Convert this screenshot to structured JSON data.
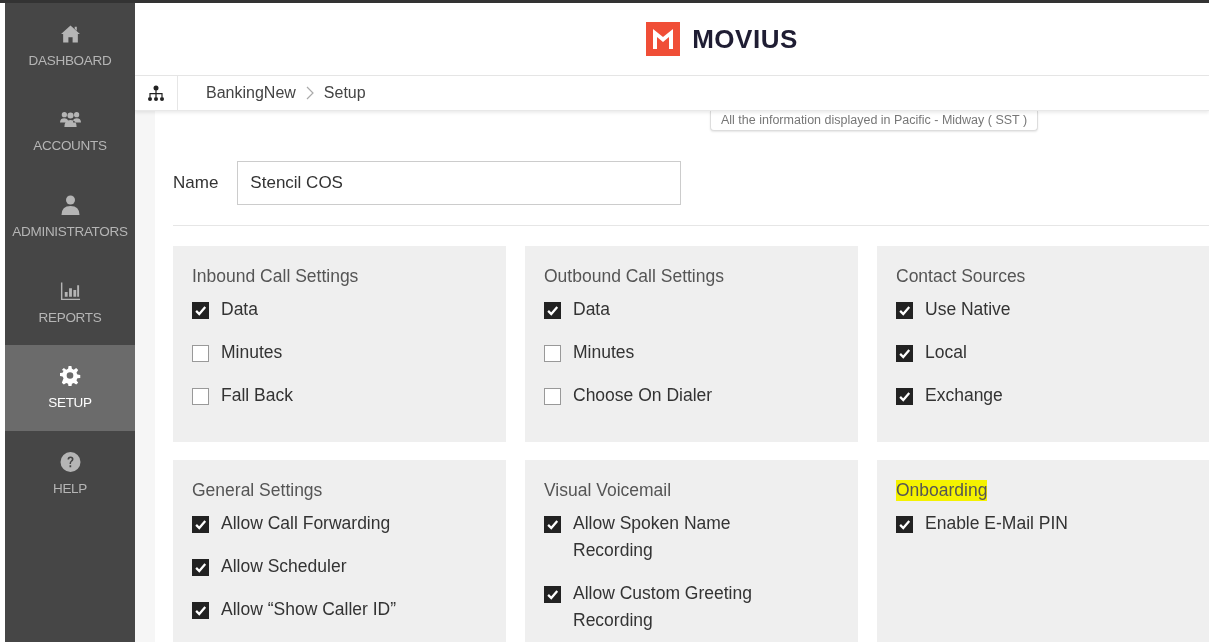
{
  "sidebar": {
    "items": [
      {
        "label": "DASHBOARD",
        "kind": "home",
        "selected": false
      },
      {
        "label": "ACCOUNTS",
        "kind": "users",
        "selected": false
      },
      {
        "label": "ADMINISTRATORS",
        "kind": "admin",
        "selected": false
      },
      {
        "label": "REPORTS",
        "kind": "chart",
        "selected": false
      },
      {
        "label": "SETUP",
        "kind": "gear",
        "selected": true
      },
      {
        "label": "HELP",
        "kind": "help",
        "selected": false
      }
    ]
  },
  "header": {
    "logo_text": "MOVIUS"
  },
  "breadcrumb": [
    "BankingNew",
    "Setup"
  ],
  "timezone_note": "All the information displayed in Pacific - Midway ( SST )",
  "name_field": {
    "label": "Name",
    "value": "Stencil COS"
  },
  "sections": [
    {
      "title": "Inbound Call Settings",
      "highlighted": false,
      "items": [
        {
          "label": "Data",
          "checked": true
        },
        {
          "label": "Minutes",
          "checked": false
        },
        {
          "label": "Fall Back",
          "checked": false
        }
      ]
    },
    {
      "title": "Outbound Call Settings",
      "highlighted": false,
      "items": [
        {
          "label": "Data",
          "checked": true
        },
        {
          "label": "Minutes",
          "checked": false
        },
        {
          "label": "Choose On Dialer",
          "checked": false
        }
      ]
    },
    {
      "title": "Contact Sources",
      "highlighted": false,
      "items": [
        {
          "label": "Use Native",
          "checked": true
        },
        {
          "label": "Local",
          "checked": true
        },
        {
          "label": "Exchange",
          "checked": true
        }
      ]
    },
    {
      "title": "General Settings",
      "highlighted": false,
      "items": [
        {
          "label": "Allow Call Forwarding",
          "checked": true
        },
        {
          "label": "Allow Scheduler",
          "checked": true
        },
        {
          "label": "Allow “Show Caller ID”",
          "checked": true
        }
      ]
    },
    {
      "title": "Visual Voicemail",
      "highlighted": false,
      "items": [
        {
          "label": "Allow Spoken Name Recording",
          "checked": true
        },
        {
          "label": "Allow Custom Greeting Recording",
          "checked": true
        }
      ]
    },
    {
      "title": "Onboarding",
      "highlighted": true,
      "items": [
        {
          "label": "Enable E-Mail PIN",
          "checked": true
        }
      ]
    }
  ]
}
